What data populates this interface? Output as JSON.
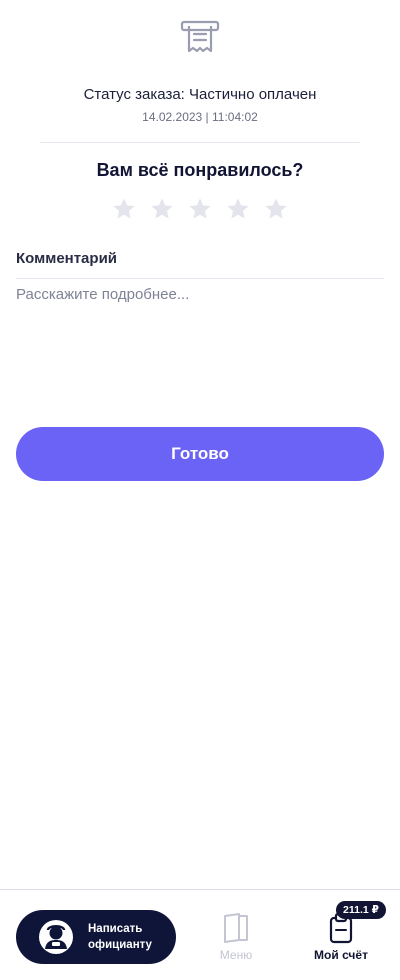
{
  "order": {
    "status_text": "Статус заказа: Частично оплачен",
    "datetime": "14.02.2023 | 11:04:02"
  },
  "rating": {
    "question": "Вам всё понравилось?",
    "max_stars": 5,
    "selected": 0
  },
  "comment": {
    "label": "Комментарий",
    "placeholder": "Расскажите подробнее...",
    "value": ""
  },
  "actions": {
    "done_label": "Готово"
  },
  "bottom_nav": {
    "waiter_label": "Написать\nофицианту",
    "menu_label": "Меню",
    "bill_label": "Мой счёт",
    "bill_amount": "211.1 ₽"
  },
  "colors": {
    "accent": "#6b63f6",
    "dark": "#0f1538",
    "star_inactive": "#e4e5ec",
    "muted": "#c3c5d0"
  },
  "icons": {
    "header": "receipt-icon",
    "star": "star-icon",
    "waiter": "waiter-avatar-icon",
    "menu": "menu-book-icon",
    "bill": "bill-clipboard-icon"
  }
}
